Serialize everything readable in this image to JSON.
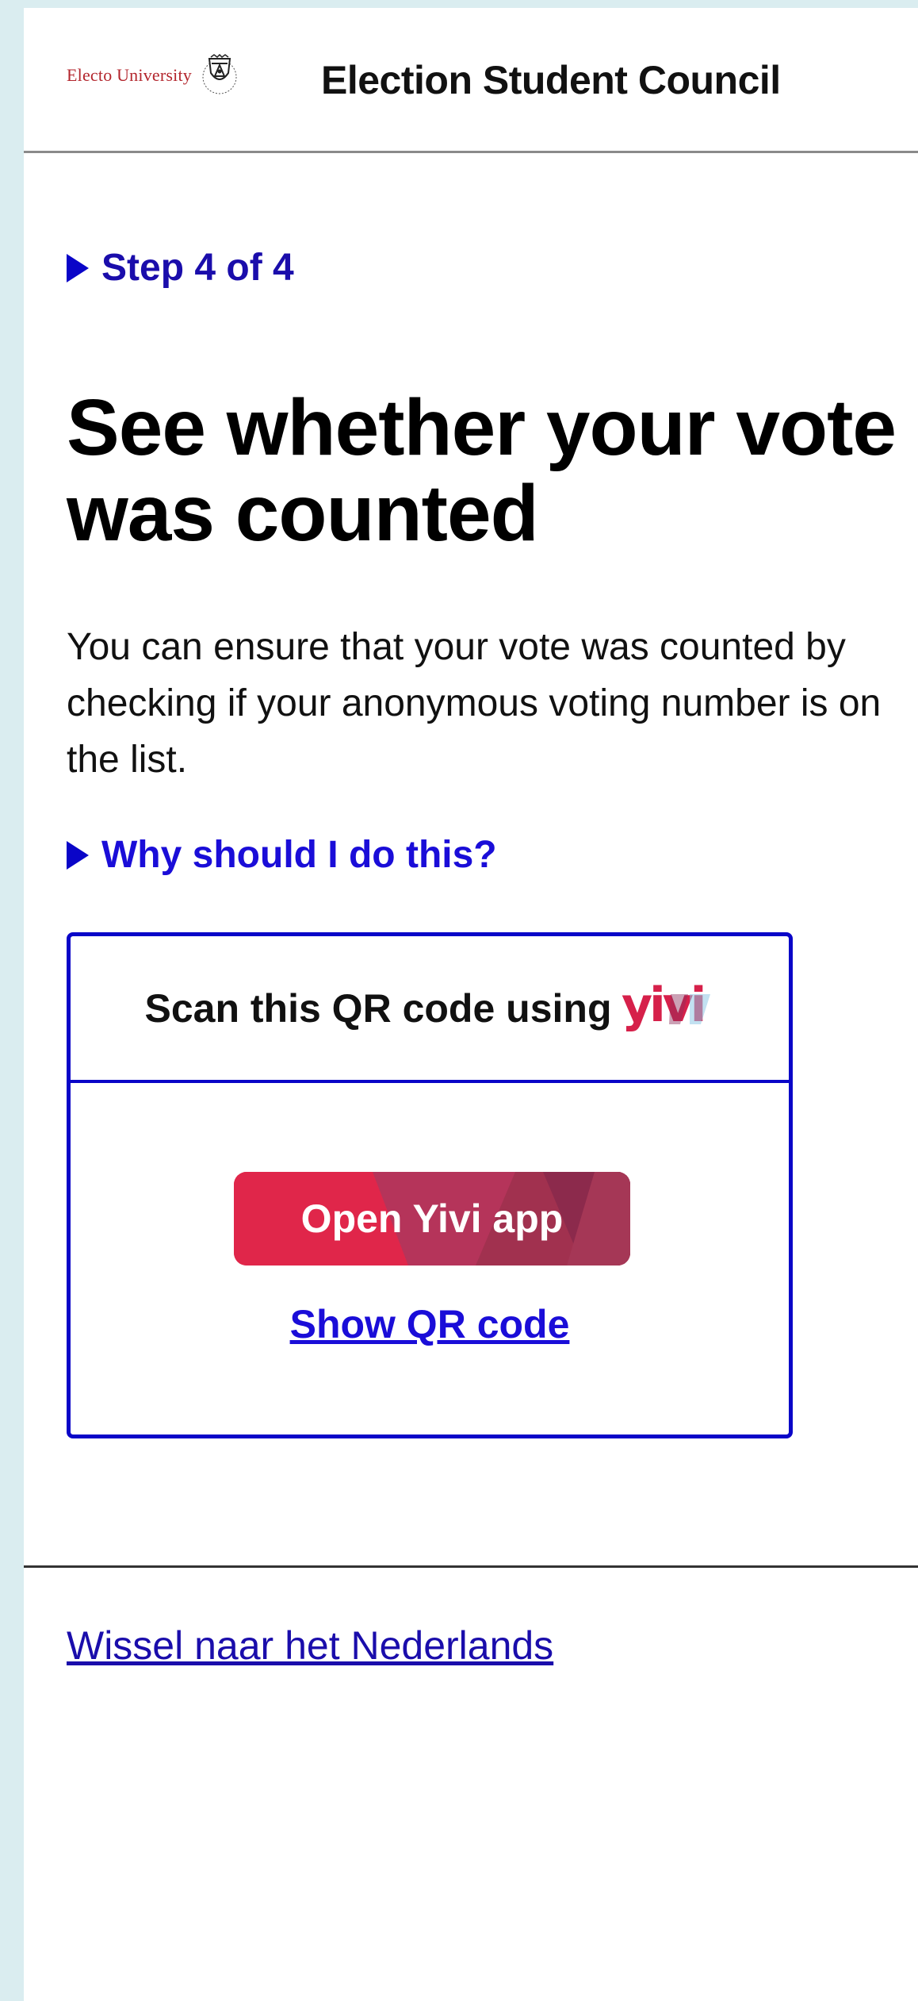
{
  "header": {
    "university_name": "Electo University",
    "site_title": "Election Student Council"
  },
  "progress": {
    "step_label": "Step 4 of 4",
    "current_step": 4,
    "total_steps": 4
  },
  "main": {
    "heading": "See whether your vote was counted",
    "intro": "You can ensure that your vote was counted by checking if your anonymous voting number is on the list.",
    "why_toggle": "Why should I do this?"
  },
  "yivi": {
    "scan_prompt": "Scan this QR code using",
    "brand": "yivi",
    "open_app_button": "Open Yivi app",
    "show_qr_link": "Show QR code",
    "button_color": "#e0264a",
    "border_color": "#0a05c8"
  },
  "footer": {
    "language_switch": "Wissel naar het Nederlands"
  },
  "icons": {
    "disclosure": "triangle-right-icon",
    "crest": "university-crest-icon"
  }
}
